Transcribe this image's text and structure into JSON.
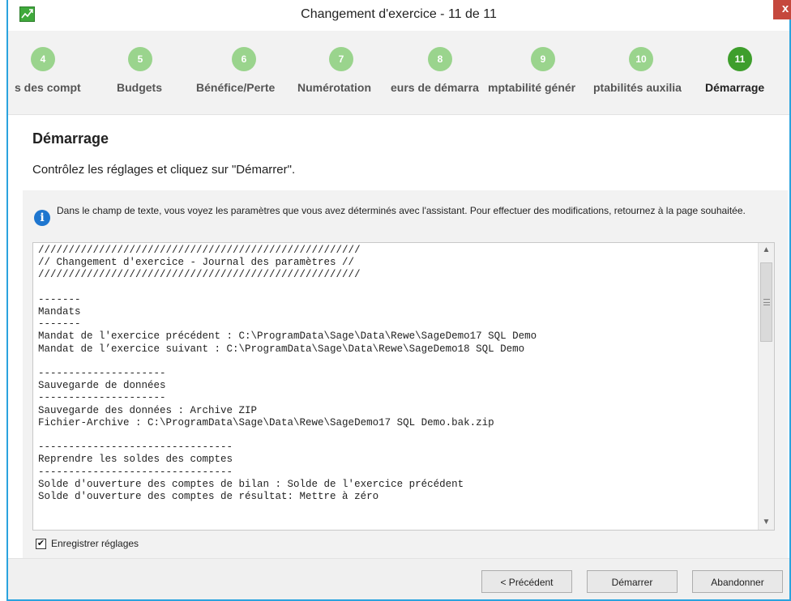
{
  "window": {
    "title": "Changement d'exercice - 11 de 11",
    "close_label": "x"
  },
  "steps": [
    {
      "number": "4",
      "label": "s des compt"
    },
    {
      "number": "5",
      "label": "Budgets"
    },
    {
      "number": "6",
      "label": "Bénéfice/Perte"
    },
    {
      "number": "7",
      "label": "Numérotation"
    },
    {
      "number": "8",
      "label": "eurs de démarra"
    },
    {
      "number": "9",
      "label": "mptabilité génér"
    },
    {
      "number": "10",
      "label": "ptabilités auxilia"
    },
    {
      "number": "11",
      "label": "Démarrage"
    }
  ],
  "page": {
    "title": "Démarrage",
    "subtitle": "Contrôlez les réglages et cliquez sur \"Démarrer\"."
  },
  "info": {
    "icon": "info-icon",
    "text": "Dans le champ de texte, vous voyez les paramètres que vous avez déterminés avec l'assistant. Pour effectuer des modifications, retournez à la page souhaitée."
  },
  "log": {
    "lines": [
      "/////////////////////////////////////////////////////",
      "// Changement d'exercice - Journal des paramètres //",
      "/////////////////////////////////////////////////////",
      "",
      "-------",
      "Mandats",
      "-------",
      "Mandat de l'exercice précédent : C:\\ProgramData\\Sage\\Data\\Rewe\\SageDemo17 SQL Demo",
      "Mandat de l’exercice suivant : C:\\ProgramData\\Sage\\Data\\Rewe\\SageDemo18 SQL Demo",
      "",
      "---------------------",
      "Sauvegarde de données",
      "---------------------",
      "Sauvegarde des données : Archive ZIP",
      "Fichier-Archive : C:\\ProgramData\\Sage\\Data\\Rewe\\SageDemo17 SQL Demo.bak.zip",
      "",
      "--------------------------------",
      "Reprendre les soldes des comptes",
      "--------------------------------",
      "Solde d'ouverture des comptes de bilan : Solde de l'exercice précédent",
      "Solde d'ouverture des comptes de résultat: Mettre à zéro"
    ]
  },
  "options": {
    "save_settings_label": "Enregistrer réglages",
    "save_settings_checked": "✔"
  },
  "buttons": {
    "previous": "< Précédent",
    "start": "Démarrer",
    "cancel": "Abandonner"
  },
  "colors": {
    "accent_frame": "#2aa3de",
    "step_done": "#9ad48d",
    "step_active": "#3e9e2c",
    "close_button": "#c5483d",
    "info_icon": "#1e76cf"
  }
}
